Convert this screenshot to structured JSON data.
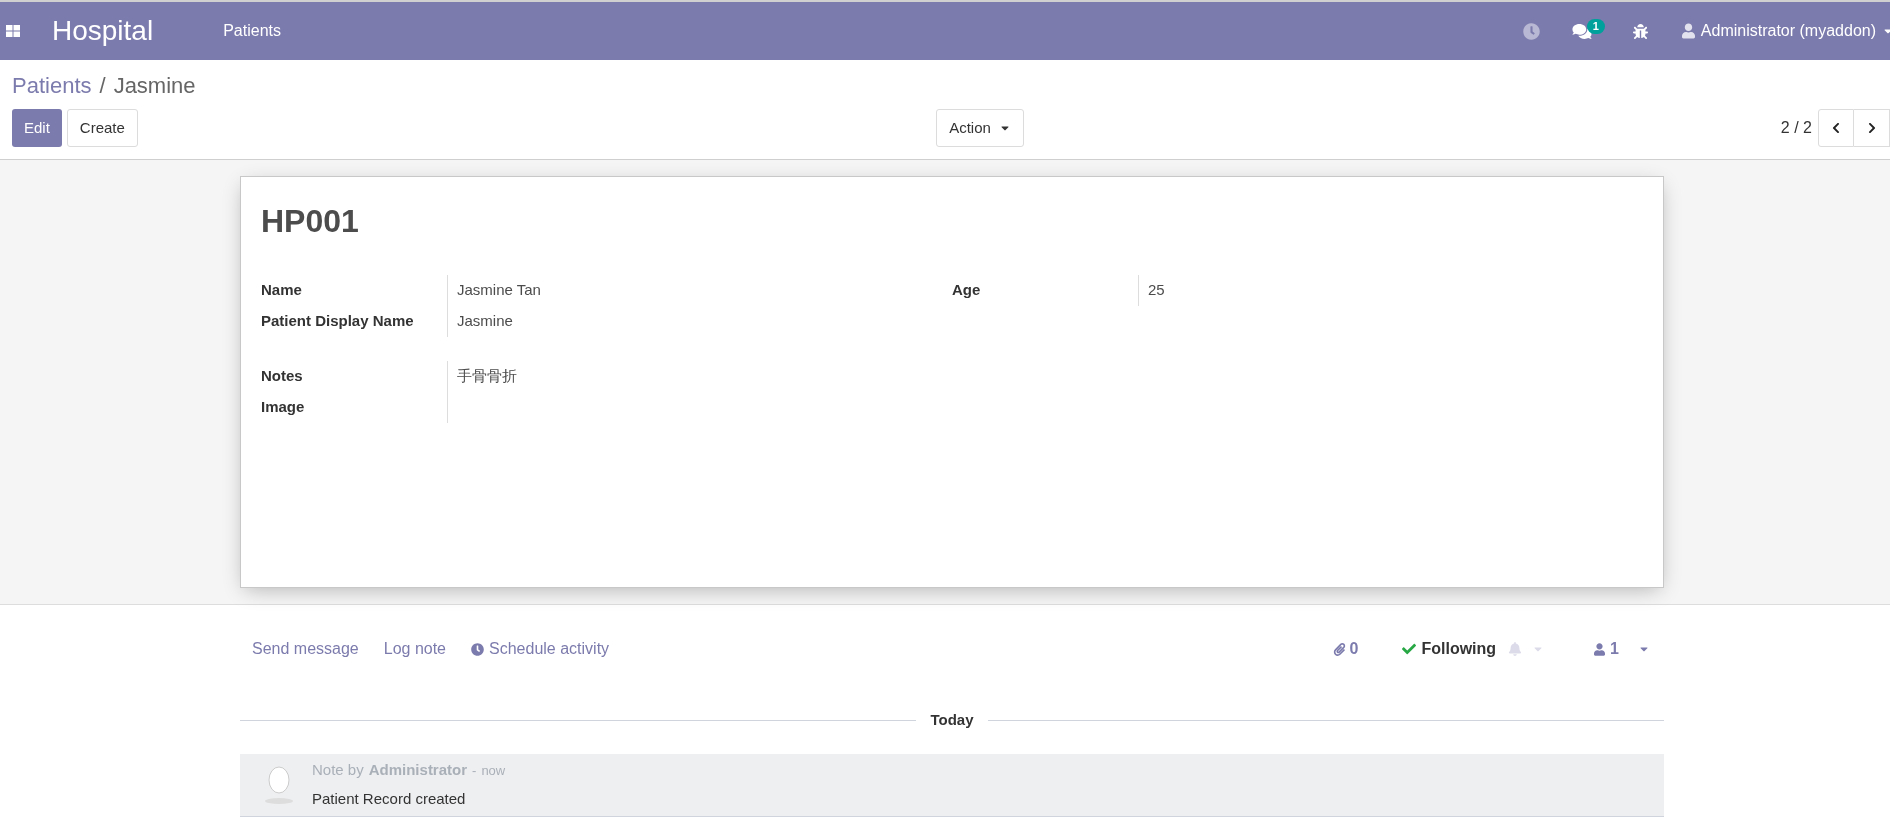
{
  "navbar": {
    "brand": "Hospital",
    "menu": [
      {
        "label": "Patients"
      }
    ],
    "messages_badge": "1",
    "user": "Administrator (myaddon)"
  },
  "breadcrumb": [
    {
      "label": "Patients"
    },
    {
      "label": "Jasmine"
    }
  ],
  "breadcrumb_separator": "/",
  "buttons": [
    {
      "label": "Edit",
      "kind": "primary"
    },
    {
      "label": "Create",
      "kind": "secondary"
    }
  ],
  "action": {
    "label": "Action"
  },
  "pager": {
    "value": "2 / 2"
  },
  "record": {
    "title": "HP001",
    "groups": [
      {
        "fields": [
          {
            "label": "Name",
            "value": "Jasmine Tan"
          },
          {
            "label": "Patient Display Name",
            "value": "Jasmine"
          }
        ]
      },
      {
        "fields": [
          {
            "label": "Age",
            "value": "25"
          }
        ]
      }
    ],
    "extra_fields": [
      {
        "label": "Notes",
        "value": "手骨骨折"
      },
      {
        "label": "Image"
      }
    ]
  },
  "chatter": {
    "actions": [
      {
        "label": "Send message"
      },
      {
        "label": "Log note"
      },
      {
        "label": "Schedule activity",
        "kind": "activity"
      }
    ],
    "attachments": "0",
    "following": true,
    "follow_label": "Following",
    "followers": "1",
    "divider": "Today",
    "messages": [
      {
        "prefix": "Note by",
        "author": "Administrator",
        "separator": "-",
        "time": "now",
        "body": "Patient Record created"
      }
    ]
  }
}
